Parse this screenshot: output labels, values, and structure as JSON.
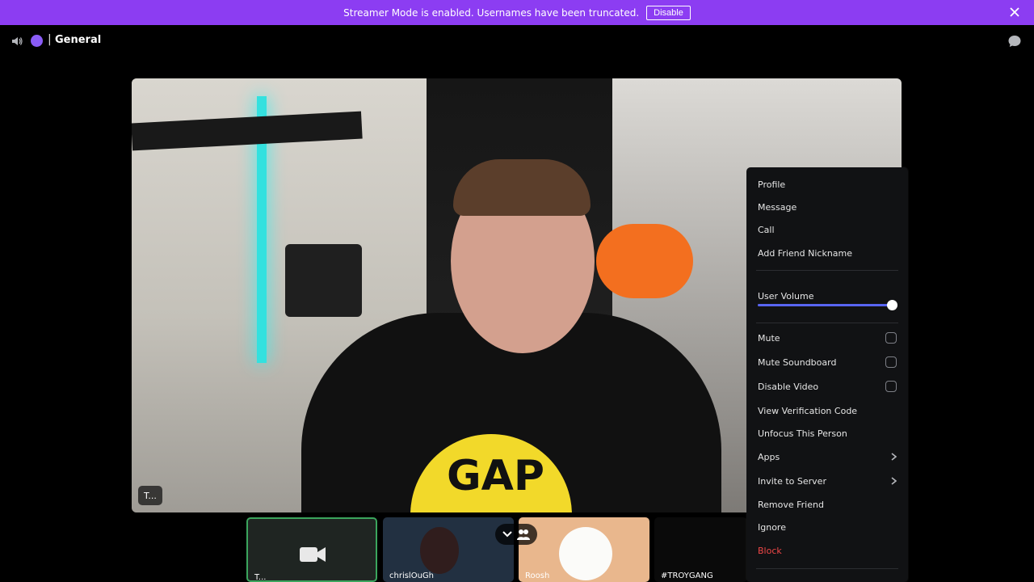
{
  "banner": {
    "text": "Streamer Mode is enabled. Usernames have been truncated.",
    "disable_label": "Disable"
  },
  "header": {
    "channel": "General",
    "separator": "|"
  },
  "stage": {
    "tag": "T...",
    "shirt_text": "GAP"
  },
  "thumbnails": [
    {
      "label": "T..."
    },
    {
      "label": "chrislOuGh"
    },
    {
      "label": "Roosh"
    },
    {
      "label": "#TROYGANG"
    }
  ],
  "context_menu": {
    "items": [
      "Profile",
      "Message",
      "Call",
      "Add Friend Nickname"
    ],
    "volume": {
      "label": "User Volume",
      "level_fraction": 0.97
    },
    "toggles": [
      "Mute",
      "Mute Soundboard",
      "Disable Video"
    ],
    "actions": [
      "View Verification Code",
      "Unfocus This Person",
      "Apps",
      "Invite to Server",
      "Remove Friend",
      "Ignore",
      "Block"
    ]
  },
  "colors": {
    "banner": "#8c3df2",
    "accent": "#5865f2",
    "danger": "#f04747",
    "speaking_border": "#3ba55d"
  }
}
